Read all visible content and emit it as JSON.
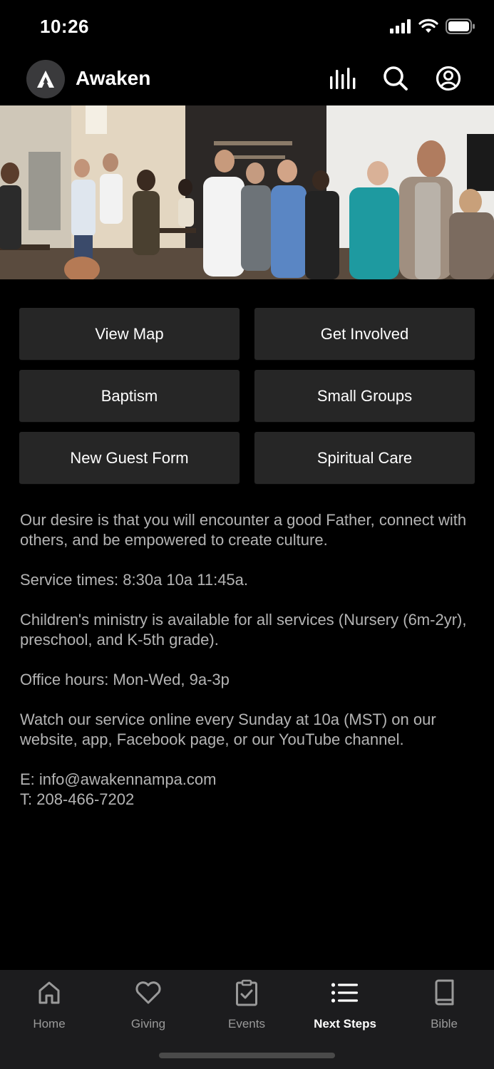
{
  "status_bar": {
    "time": "10:26"
  },
  "header": {
    "title": "Awaken",
    "icons": [
      "logo-a-icon",
      "audio-bars-icon",
      "search-icon",
      "account-icon"
    ]
  },
  "buttons": [
    {
      "label": "View Map"
    },
    {
      "label": "Get Involved"
    },
    {
      "label": "Baptism"
    },
    {
      "label": "Small Groups"
    },
    {
      "label": "New Guest Form"
    },
    {
      "label": "Spiritual Care"
    }
  ],
  "info": {
    "desire": "Our desire is that you will encounter a good Father, connect with others, and be empowered to create culture.",
    "service_times": "Service times: 8:30a 10a 11:45a.",
    "children": "Children's ministry is available for all services (Nursery (6m-2yr), preschool, and K-5th grade).",
    "office_hours": "Office hours: Mon-Wed, 9a-3p",
    "watch_online": "Watch our service online every Sunday at 10a (MST) on our website, app, Facebook page, or our YouTube channel.",
    "email": "E: info@awakennampa.com",
    "phone": "T: 208-466-7202"
  },
  "tabs": [
    {
      "label": "Home",
      "icon": "home-icon",
      "active": false
    },
    {
      "label": "Giving",
      "icon": "heart-icon",
      "active": false
    },
    {
      "label": "Events",
      "icon": "clipboard-check-icon",
      "active": false
    },
    {
      "label": "Next Steps",
      "icon": "list-icon",
      "active": true
    },
    {
      "label": "Bible",
      "icon": "book-icon",
      "active": false
    }
  ],
  "colors": {
    "background": "#000000",
    "button_bg": "#262626",
    "tab_bar_bg": "#1c1c1e",
    "body_text": "#b4b4b4",
    "inactive_tab": "#9a9a9a",
    "active_tab": "#ffffff"
  }
}
